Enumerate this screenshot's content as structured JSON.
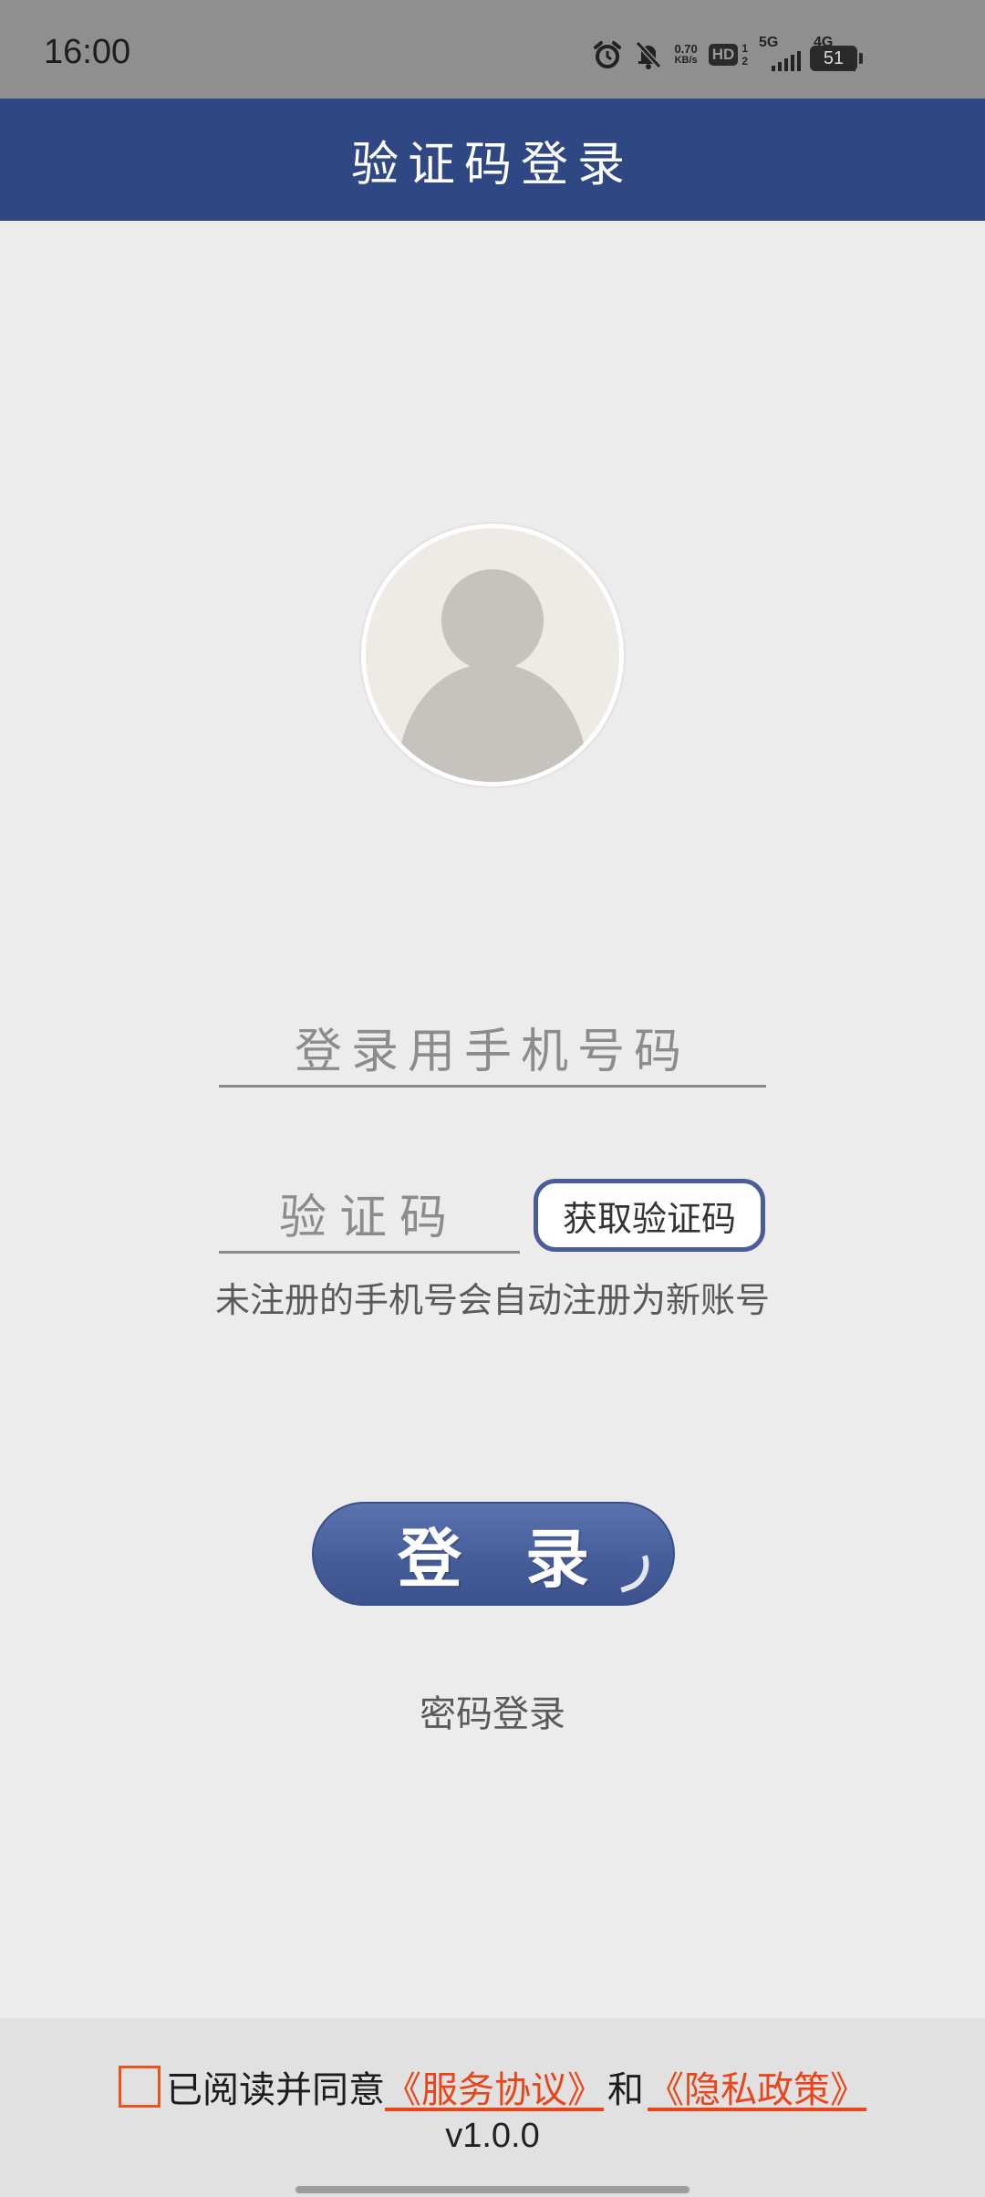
{
  "status_bar": {
    "time": "16:00",
    "net_speed_value": "0.70",
    "net_speed_unit": "KB/s",
    "hd_label": "HD",
    "hd_sub_top": "1",
    "hd_sub_bottom": "2",
    "signal1_label": "5G",
    "signal2_label": "4G",
    "battery_level": "51",
    "icons": [
      "alarm-icon",
      "mute-bell-icon"
    ]
  },
  "header": {
    "title": "验证码登录"
  },
  "form": {
    "phone_placeholder": "登录用手机号码",
    "code_placeholder": "验证码",
    "get_code_label": "获取验证码",
    "hint": "未注册的手机号会自动注册为新账号",
    "login_label": "登录",
    "password_login_label": "密码登录"
  },
  "footer": {
    "agree_prefix": "已阅读并同意",
    "service_link": "《服务协议》",
    "and_text": "和",
    "privacy_link": "《隐私政策》",
    "version": "v1.0.0"
  },
  "colors": {
    "header_bg": "#2f4883",
    "status_bar_bg": "#8f8f8f",
    "page_bg": "#ececec",
    "footer_bg": "#e1e1e1",
    "button_border": "#4a5d9a",
    "link_color": "#e8461a"
  }
}
